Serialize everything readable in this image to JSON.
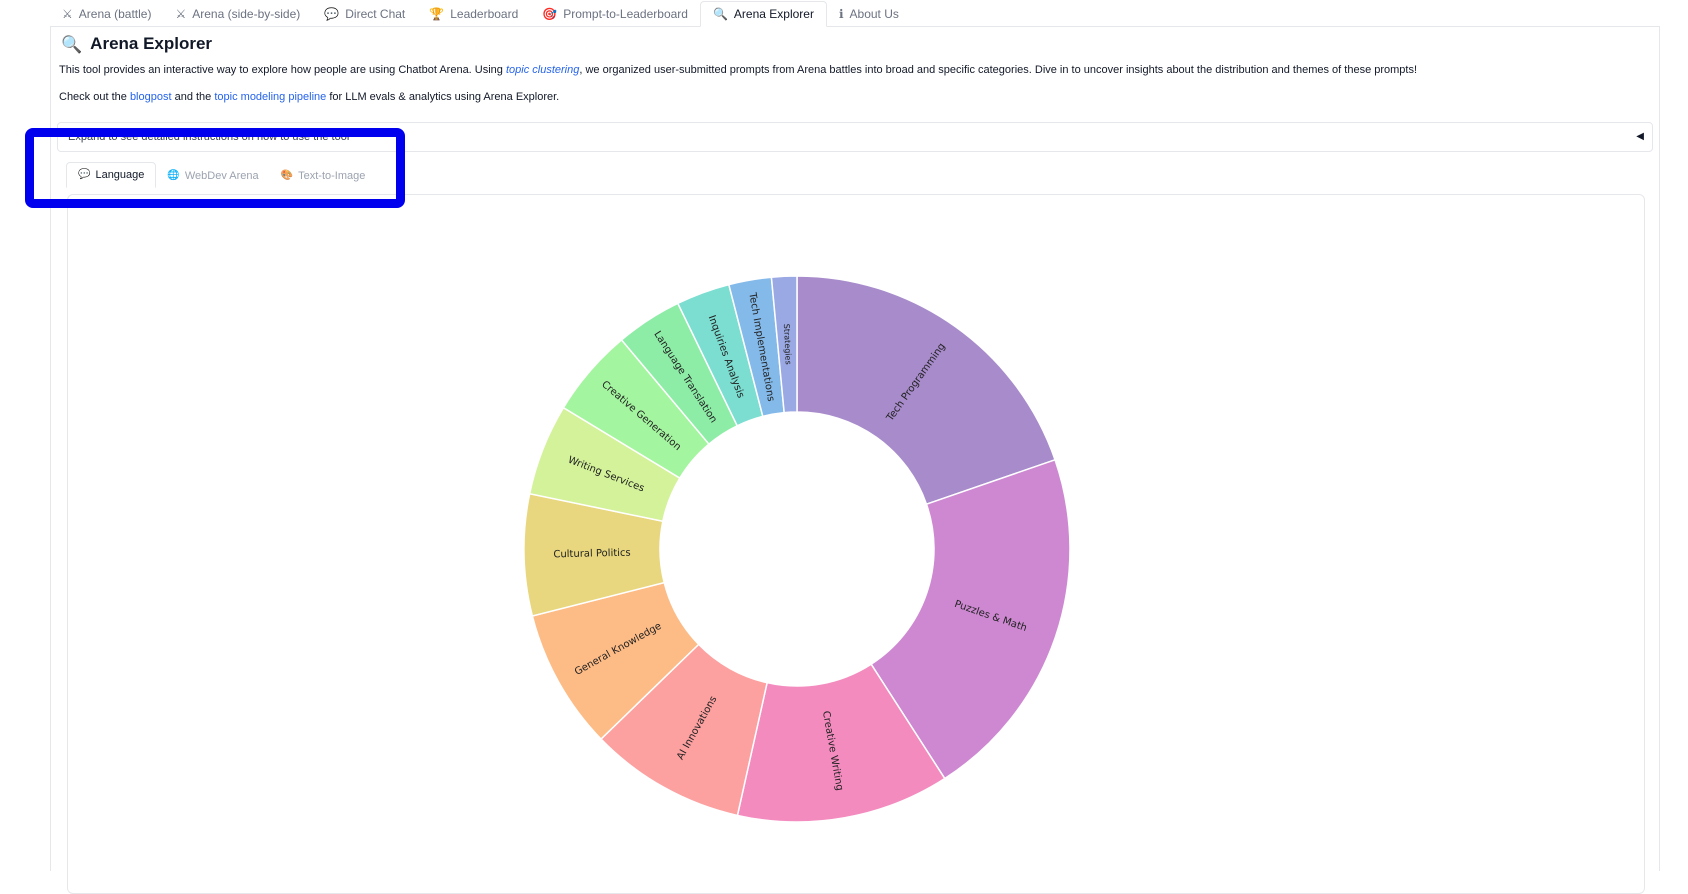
{
  "top_tabs": [
    {
      "icon": "⚔",
      "label": "Arena (battle)",
      "name": "tab-arena-battle",
      "active": false
    },
    {
      "icon": "⚔",
      "label": "Arena (side-by-side)",
      "name": "tab-arena-side-by-side",
      "active": false
    },
    {
      "icon": "💬",
      "label": "Direct Chat",
      "name": "tab-direct-chat",
      "active": false
    },
    {
      "icon": "🏆",
      "label": "Leaderboard",
      "name": "tab-leaderboard",
      "active": false
    },
    {
      "icon": "🎯",
      "label": "Prompt-to-Leaderboard",
      "name": "tab-prompt-to-leaderboard",
      "active": false
    },
    {
      "icon": "🔍",
      "label": "Arena Explorer",
      "name": "tab-arena-explorer",
      "active": true
    },
    {
      "icon": "ℹ",
      "label": "About Us",
      "name": "tab-about-us",
      "active": false
    }
  ],
  "page": {
    "title": "Arena Explorer",
    "title_icon": "magnifier-icon",
    "intro_before": "This tool provides an interactive way to explore how people are using Chatbot Arena. Using ",
    "intro_link": "topic clustering",
    "intro_after": ", we organized user-submitted prompts from Arena battles into broad and specific categories. Dive in to uncover insights about the distribution and themes of these prompts!",
    "check_before": "Check out the ",
    "check_link1": "blogpost",
    "check_mid": " and the ",
    "check_link2": "topic modeling pipeline",
    "check_after": " for LLM evals & analytics using Arena Explorer.",
    "accordion_label": "Expand to see detailed instructions on how to use the tool",
    "accordion_arrow": "◀"
  },
  "sub_tabs": [
    {
      "icon": "💬",
      "label": "Language",
      "name": "subtab-language",
      "active": true
    },
    {
      "icon": "🌐",
      "label": "WebDev Arena",
      "name": "subtab-webdev-arena",
      "active": false
    },
    {
      "icon": "🎨",
      "label": "Text-to-Image",
      "name": "subtab-text-to-image",
      "active": false
    }
  ],
  "highlight_color": "#0000ee",
  "chart_data": {
    "type": "pie",
    "donut": true,
    "categories": [
      "Tech Programming",
      "Puzzles & Math",
      "Creative Writing",
      "AI Innovations",
      "General Knowledge",
      "Cultural Politics",
      "Writing Services",
      "Creative Generation",
      "Language Translation",
      "Inquiries Analysis",
      "Tech Implementations",
      "Strategies"
    ],
    "values": [
      21.1,
      22.7,
      13.5,
      9.9,
      8.9,
      7.7,
      5.8,
      5.6,
      4.2,
      3.4,
      2.7,
      1.6
    ],
    "colors": [
      "#a78bcb",
      "#cd88d1",
      "#f48bbf",
      "#fca0a0",
      "#fdbb86",
      "#e8d77e",
      "#d3f299",
      "#a4f59f",
      "#8deda7",
      "#7bded1",
      "#84baea",
      "#9aa8e3"
    ]
  }
}
